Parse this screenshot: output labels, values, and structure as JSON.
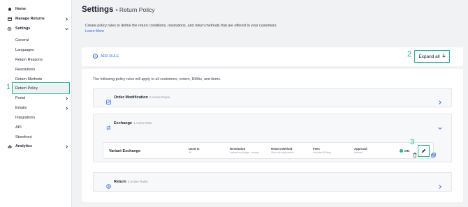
{
  "sidebar": {
    "items": [
      {
        "label": "Home",
        "icon": "home-icon",
        "type": "top"
      },
      {
        "label": "Manage Returns",
        "icon": "returns-icon",
        "type": "top",
        "chevron": "right"
      },
      {
        "label": "Settings",
        "icon": "gear-icon",
        "type": "top",
        "chevron": "down"
      },
      {
        "label": "General",
        "type": "sub"
      },
      {
        "label": "Languages",
        "type": "sub"
      },
      {
        "label": "Return Reasons",
        "type": "sub"
      },
      {
        "label": "Resolutions",
        "type": "sub"
      },
      {
        "label": "Return Methods",
        "type": "sub"
      },
      {
        "label": "Return Policy",
        "type": "sub",
        "active": true
      },
      {
        "label": "Portal",
        "type": "sub",
        "chevron": "right"
      },
      {
        "label": "Emails",
        "type": "sub",
        "chevron": "right"
      },
      {
        "label": "Integrations",
        "type": "sub"
      },
      {
        "label": "API",
        "type": "sub"
      },
      {
        "label": "Storefront",
        "type": "sub"
      },
      {
        "label": "Analytics",
        "icon": "analytics-icon",
        "type": "top",
        "chevron": "right"
      }
    ],
    "step_number": "1"
  },
  "page": {
    "title": "Settings",
    "subtitle": "Return Policy",
    "description": "Create policy rules to define the return conditions, resolutions, and return methods that are offered to your customers.",
    "learn_more": "Learn More"
  },
  "toolbar": {
    "add_rule": "ADD RULE",
    "expand_all": "Expand all",
    "step_number": "2"
  },
  "rules": {
    "intro": "The following policy rules will apply to all customers, orders, RMAs, and items.",
    "groups": [
      {
        "name": "Order Modification",
        "count": "0 Active Rules"
      },
      {
        "name": "Exchange",
        "count": "1 Active Rule"
      },
      {
        "name": "Return",
        "count": "2 Active Rules"
      }
    ],
    "variant": {
      "name": "Variant Exchange",
      "columns": [
        {
          "header": "Used In",
          "value": "All"
        },
        {
          "header": "Resolution",
          "value": "Variant exchange - Instant"
        },
        {
          "header": "Return Method",
          "value": "Ship with any carrier"
        },
        {
          "header": "Fees",
          "value": "Includes $0 fees"
        },
        {
          "header": "Approval",
          "value": "Manual"
        }
      ],
      "status": "ON"
    },
    "step_number": "3"
  },
  "colors": {
    "accent": "#1bb597",
    "link": "#2d6ad6",
    "background": "#f1f2f4"
  }
}
